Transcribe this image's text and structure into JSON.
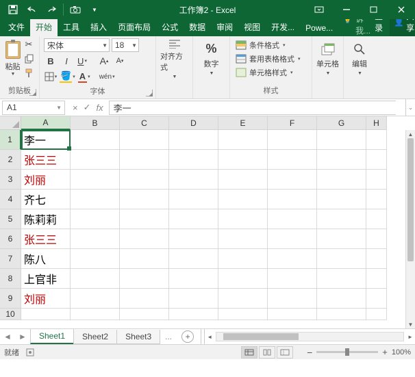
{
  "window": {
    "title": "工作簿2 - Excel"
  },
  "tabs": {
    "file": "文件",
    "home": "开始",
    "tools": "工具",
    "insert": "插入",
    "layout": "页面布局",
    "formulas": "公式",
    "data": "数据",
    "review": "审阅",
    "view": "视图",
    "developer": "开发...",
    "power": "Powe...",
    "tellme": "告诉我...",
    "login": "登录",
    "share": "共享"
  },
  "ribbon": {
    "clipboard": {
      "paste": "粘贴",
      "label": "剪贴板"
    },
    "font": {
      "name": "宋体",
      "size": "18",
      "label": "字体",
      "wen": "wén"
    },
    "align": {
      "label": "对齐方式"
    },
    "number": {
      "label": "数字",
      "percent": "%"
    },
    "styles": {
      "cond": "条件格式",
      "table": "套用表格格式",
      "cell": "单元格样式",
      "label": "样式"
    },
    "cells": {
      "label": "单元格"
    },
    "editing": {
      "label": "编辑"
    }
  },
  "formula": {
    "ref": "A1",
    "fx": "fx",
    "value": "李一",
    "cancel": "×",
    "ok": "✓"
  },
  "grid": {
    "cols": [
      "A",
      "B",
      "C",
      "D",
      "E",
      "F",
      "G",
      "H"
    ],
    "rows": [
      "1",
      "2",
      "3",
      "4",
      "5",
      "6",
      "7",
      "8",
      "9",
      "10"
    ],
    "dataRowHeight": 29,
    "cells": {
      "A1": {
        "v": "李一",
        "red": false
      },
      "A2": {
        "v": "张三三",
        "red": true
      },
      "A3": {
        "v": "刘丽",
        "red": true
      },
      "A4": {
        "v": "齐七",
        "red": false
      },
      "A5": {
        "v": "陈莉莉",
        "red": false
      },
      "A6": {
        "v": "张三三",
        "red": true
      },
      "A7": {
        "v": "陈八",
        "red": false
      },
      "A8": {
        "v": "上官非",
        "red": false
      },
      "A9": {
        "v": "刘丽",
        "red": true
      }
    },
    "active": "A1"
  },
  "sheets": {
    "s1": "Sheet1",
    "s2": "Sheet2",
    "s3": "Sheet3",
    "dots": "...",
    "add": "+"
  },
  "status": {
    "ready": "就绪",
    "zoom": "100%",
    "minus": "−",
    "plus": "+"
  }
}
